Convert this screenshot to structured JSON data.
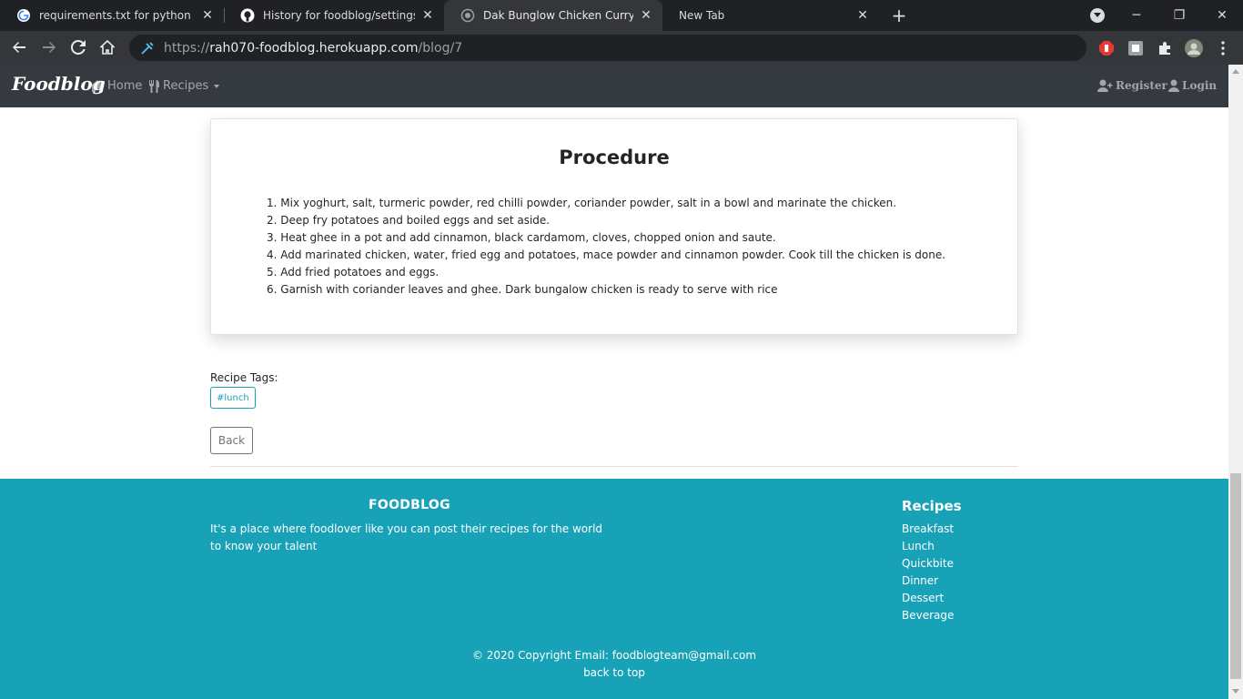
{
  "browser": {
    "tabs": [
      {
        "title": "requirements.txt for python insta",
        "icon": "google-icon",
        "active": false
      },
      {
        "title": "History for foodblog/settings.py",
        "icon": "github-icon",
        "active": false
      },
      {
        "title": "Dak Bunglow Chicken Curry by ra",
        "icon": "globe-icon",
        "active": true
      },
      {
        "title": "New Tab",
        "icon": "",
        "active": false
      }
    ],
    "url": {
      "scheme": "https://",
      "host": "rah070-foodblog.herokuapp.com",
      "path": "/blog/7"
    }
  },
  "navbar": {
    "brand": "Foodblog",
    "home": "Home",
    "recipes": "Recipes",
    "register": "Register",
    "login": "Login"
  },
  "procedure": {
    "title": "Procedure",
    "steps": [
      "1. Mix yoghurt, salt, turmeric powder, red chilli powder, coriander powder, salt in a bowl and marinate the chicken.",
      "2. Deep fry potatoes and boiled eggs and set aside.",
      "3. Heat ghee in a pot and add cinnamon, black cardamom, cloves, chopped onion and saute.",
      "4. Add marinated chicken, water, fried egg and potatoes, mace powder and cinnamon powder. Cook till the chicken is done.",
      "5. Add fried potatoes and eggs.",
      "6. Garnish with coriander leaves and ghee. Dark bungalow chicken is ready to serve with rice"
    ]
  },
  "tags": {
    "label": "Recipe Tags:",
    "items": [
      "#lunch"
    ]
  },
  "back_label": "Back",
  "footer": {
    "title": "FOODBLOG",
    "description": "It's a place where foodlover like you can post their recipes for the world to know your talent",
    "recipes_title": "Recipes",
    "recipes": [
      "Breakfast",
      "Lunch",
      "Quickbite",
      "Dinner",
      "Dessert",
      "Beverage"
    ],
    "copyright": "© 2020 Copyright Email: foodblogteam@gmail.com",
    "back_to_top": "back to top"
  },
  "colors": {
    "navbar": "#343a40",
    "footer": "#17a2b8",
    "tag": "#17a2b8"
  }
}
